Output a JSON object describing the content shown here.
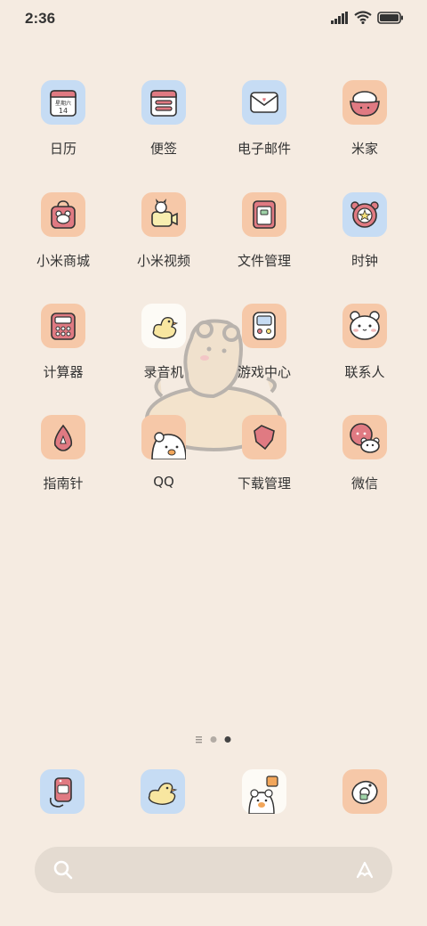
{
  "status_bar": {
    "time": "2:36"
  },
  "apps": [
    {
      "label": "日历",
      "icon": "calendar-icon",
      "bg": "blue",
      "weekday": "星期六",
      "day": "14"
    },
    {
      "label": "便签",
      "icon": "notes-icon",
      "bg": "blue"
    },
    {
      "label": "电子邮件",
      "icon": "mail-icon",
      "bg": "blue"
    },
    {
      "label": "米家",
      "icon": "rice-bowl-icon",
      "bg": "peach"
    },
    {
      "label": "小米商城",
      "icon": "shopping-bag-icon",
      "bg": "peach"
    },
    {
      "label": "小米视频",
      "icon": "video-camera-icon",
      "bg": "peach"
    },
    {
      "label": "文件管理",
      "icon": "file-folder-icon",
      "bg": "peach"
    },
    {
      "label": "时钟",
      "icon": "clock-icon",
      "bg": "blue"
    },
    {
      "label": "计算器",
      "icon": "calculator-icon",
      "bg": "peach"
    },
    {
      "label": "录音机",
      "icon": "recorder-duck-icon",
      "bg": "white"
    },
    {
      "label": "游戏中心",
      "icon": "game-controller-icon",
      "bg": "peach"
    },
    {
      "label": "联系人",
      "icon": "contacts-bear-icon",
      "bg": "peach"
    },
    {
      "label": "指南针",
      "icon": "compass-icon",
      "bg": "peach"
    },
    {
      "label": "QQ",
      "icon": "qq-bear-icon",
      "bg": "peach"
    },
    {
      "label": "下载管理",
      "icon": "download-icon",
      "bg": "peach"
    },
    {
      "label": "微信",
      "icon": "wechat-bear-icon",
      "bg": "peach"
    }
  ],
  "dock": [
    {
      "icon": "phone-icon",
      "bg": "blue"
    },
    {
      "icon": "messages-duck-icon",
      "bg": "blue"
    },
    {
      "icon": "gallery-bears-icon",
      "bg": "white"
    },
    {
      "icon": "camera-icon",
      "bg": "peach"
    }
  ],
  "pages": {
    "count": 3,
    "current": 3
  },
  "colors": {
    "background": "#f5ebe1",
    "tile_blue": "#c6dcf4",
    "tile_peach": "#f6c8a8",
    "tile_white": "#fdfbf6",
    "icon_pink": "#e07a82",
    "search_bar": "#e4dbd1"
  }
}
